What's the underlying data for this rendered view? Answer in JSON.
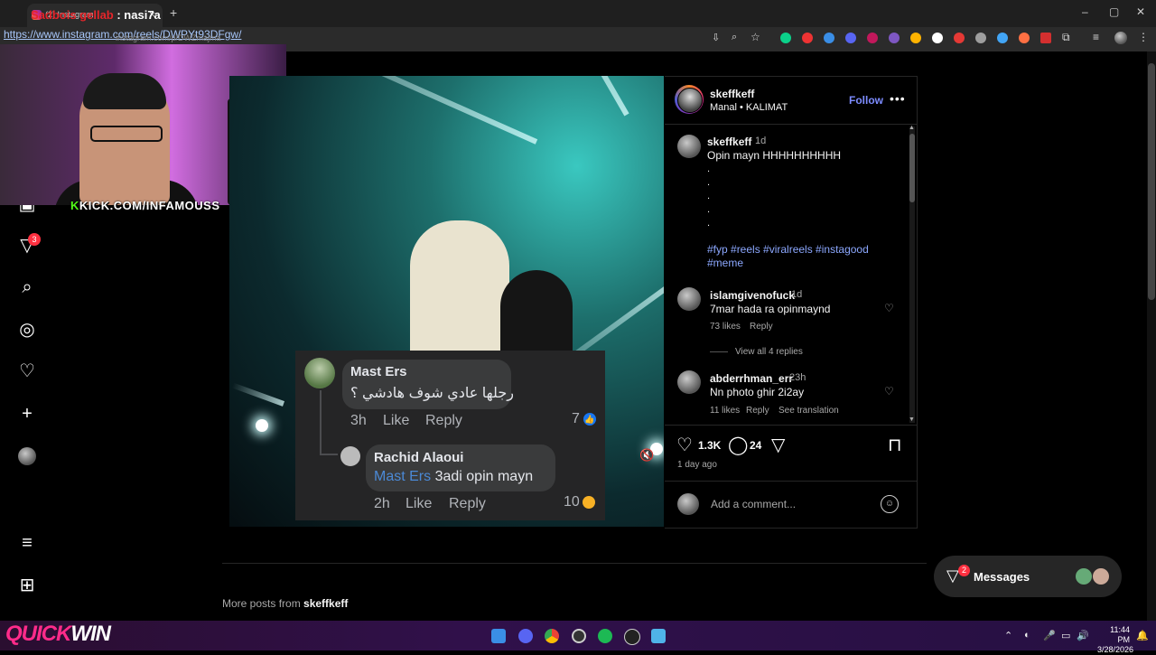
{
  "browser": {
    "tab_title": "(2) Instagram",
    "overlay_title_red": "Sadbois gellab",
    "overlay_title_white": " : nasi7a",
    "url": "https://www.instagram.com/reels/DWPYt93DFgw/",
    "url_faint": "instagram.com/p/DWZmajma"
  },
  "stream": {
    "kick_prefix": "K",
    "kick_text": "KICK.COM/INFAMOUSS"
  },
  "sidebar": {
    "notif_count": "3"
  },
  "post": {
    "author": "skeffkeff",
    "audio": "Manal • KALIMAT",
    "follow_label": "Follow",
    "more_label": "•••",
    "caption": {
      "author": "skeffkeff",
      "time": "1d",
      "text": "Opin mayn HHHHHHHHHH",
      "dots": [
        ".",
        ".",
        ".",
        ".",
        "."
      ],
      "tags_line1": "#fyp #reels #viralreels #instagood",
      "tags_line2": "#meme"
    },
    "comments": [
      {
        "user": "islamgivenofuck",
        "time": "1d",
        "text": "7mar hada ra opinmaynd",
        "likes": "73 likes",
        "reply": "Reply",
        "view_replies": "View all 4 replies"
      },
      {
        "user": "abderrhman_err",
        "time": "23h",
        "text": "Nn photo ghir 2i2ay",
        "likes": "11 likes",
        "reply": "Reply",
        "translate": "See translation"
      }
    ],
    "likes_count": "1.3K",
    "comments_count": "24",
    "date": "1 day ago",
    "add_comment_placeholder": "Add a comment..."
  },
  "fb_card": {
    "c1_name": "Mast Ers",
    "c1_text": "رجلها عادي شوف هادشي ؟",
    "c1_time": "3h",
    "c1_like": "Like",
    "c1_reply": "Reply",
    "c1_count": "7",
    "c2_name": "Rachid Alaoui",
    "c2_mention": "Mast Ers",
    "c2_text": " 3adi opin mayn",
    "c2_time": "2h",
    "c2_like": "Like",
    "c2_reply": "Reply",
    "c2_count": "10"
  },
  "footer": {
    "more_posts_prefix": "More posts from ",
    "more_posts_user": "skeffkeff"
  },
  "messages": {
    "label": "Messages",
    "badge": "2"
  },
  "taskbar": {
    "quickwin_pink": "QUICK",
    "quickwin_white": "WIN",
    "time": "11:44 PM",
    "date": "3/28/2026"
  },
  "colors": {
    "accent_blue": "#7d8cff",
    "notif_red": "#ff3040",
    "kick_green": "#53fc18"
  }
}
